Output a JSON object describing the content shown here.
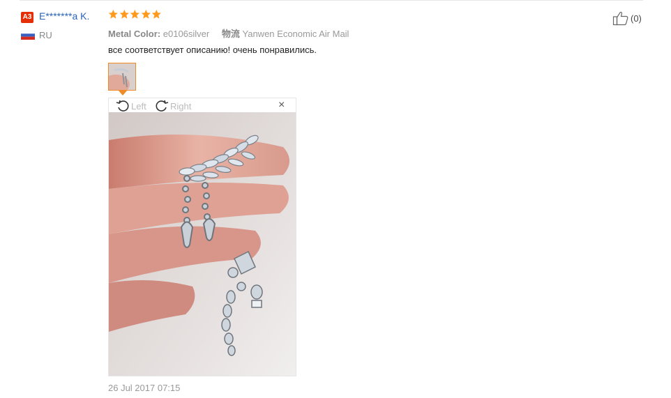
{
  "reviewer": {
    "badge": "A3",
    "name": "E*******a K.",
    "country": "RU"
  },
  "rating": {
    "stars": 5,
    "max": 5,
    "color": "#ff9a1c"
  },
  "meta": {
    "color_label": "Metal Color:",
    "color_value": "e0106silver",
    "shipping_label": "物流",
    "shipping_value": "Yanwen Economic Air Mail"
  },
  "review_text": "все соответствует описанию! очень понравились.",
  "viewer": {
    "rotate_left": "Left",
    "rotate_right": "Right",
    "close": "×"
  },
  "date": "26 Jul 2017 07:15",
  "like": {
    "count": "(0)"
  },
  "colors": {
    "badge": "#e62e04",
    "username": "#2a64b8",
    "thumb_border": "#f08a24"
  }
}
